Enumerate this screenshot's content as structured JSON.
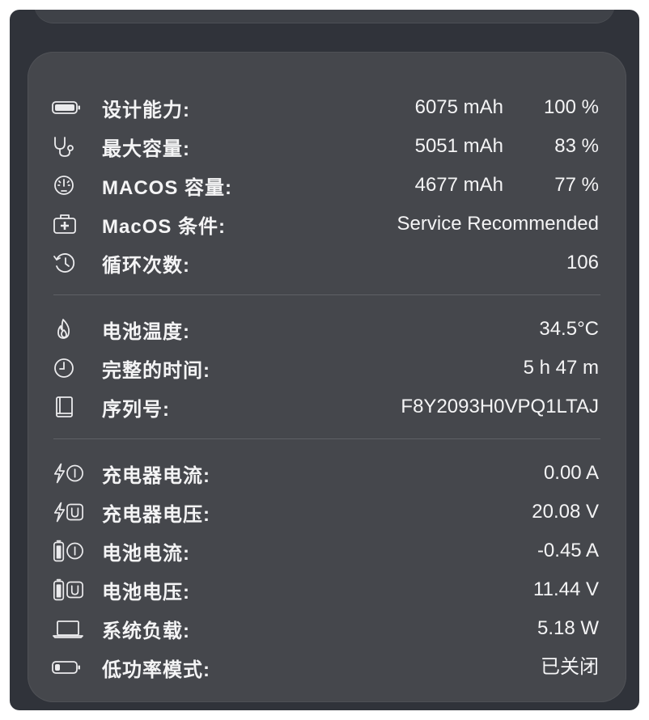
{
  "battery_info": {
    "design_capacity": {
      "label": "设计能力:",
      "value": "6075 mAh",
      "percent": "100 %",
      "icon": "battery-full-icon"
    },
    "max_capacity": {
      "label": "最大容量:",
      "value": "5051 mAh",
      "percent": "83 %",
      "icon": "stethoscope-icon"
    },
    "macos_capacity": {
      "label": "MACOS 容量:",
      "value": "4677 mAh",
      "percent": "77 %",
      "icon": "gauge-icon"
    },
    "macos_condition": {
      "label": "MacOS 条件:",
      "value": "Service Recommended",
      "icon": "medical-kit-icon"
    },
    "cycle_count": {
      "label": "循环次数:",
      "value": "106",
      "icon": "history-icon"
    }
  },
  "status_info": {
    "temperature": {
      "label": "电池温度:",
      "value": "34.5°C",
      "icon": "flame-icon"
    },
    "time_remaining": {
      "label": "完整的时间:",
      "value": "5 h 47 m",
      "icon": "clock-icon"
    },
    "serial_number": {
      "label": "序列号:",
      "value": "F8Y2093H0VPQ1LTAJ",
      "icon": "book-icon"
    }
  },
  "power_info": {
    "charger_current": {
      "label": "充电器电流:",
      "value": "0.00 A",
      "icon": "charger-current-icon"
    },
    "charger_voltage": {
      "label": "充电器电压:",
      "value": "20.08 V",
      "icon": "charger-voltage-icon"
    },
    "battery_current": {
      "label": "电池电流:",
      "value": "-0.45 A",
      "icon": "battery-current-icon"
    },
    "battery_voltage": {
      "label": "电池电压:",
      "value": "11.44 V",
      "icon": "battery-voltage-icon"
    },
    "system_load": {
      "label": "系统负载:",
      "value": "5.18 W",
      "icon": "laptop-icon"
    },
    "low_power_mode": {
      "label": "低功率模式:",
      "value": "已关闭",
      "icon": "battery-low-icon"
    }
  }
}
